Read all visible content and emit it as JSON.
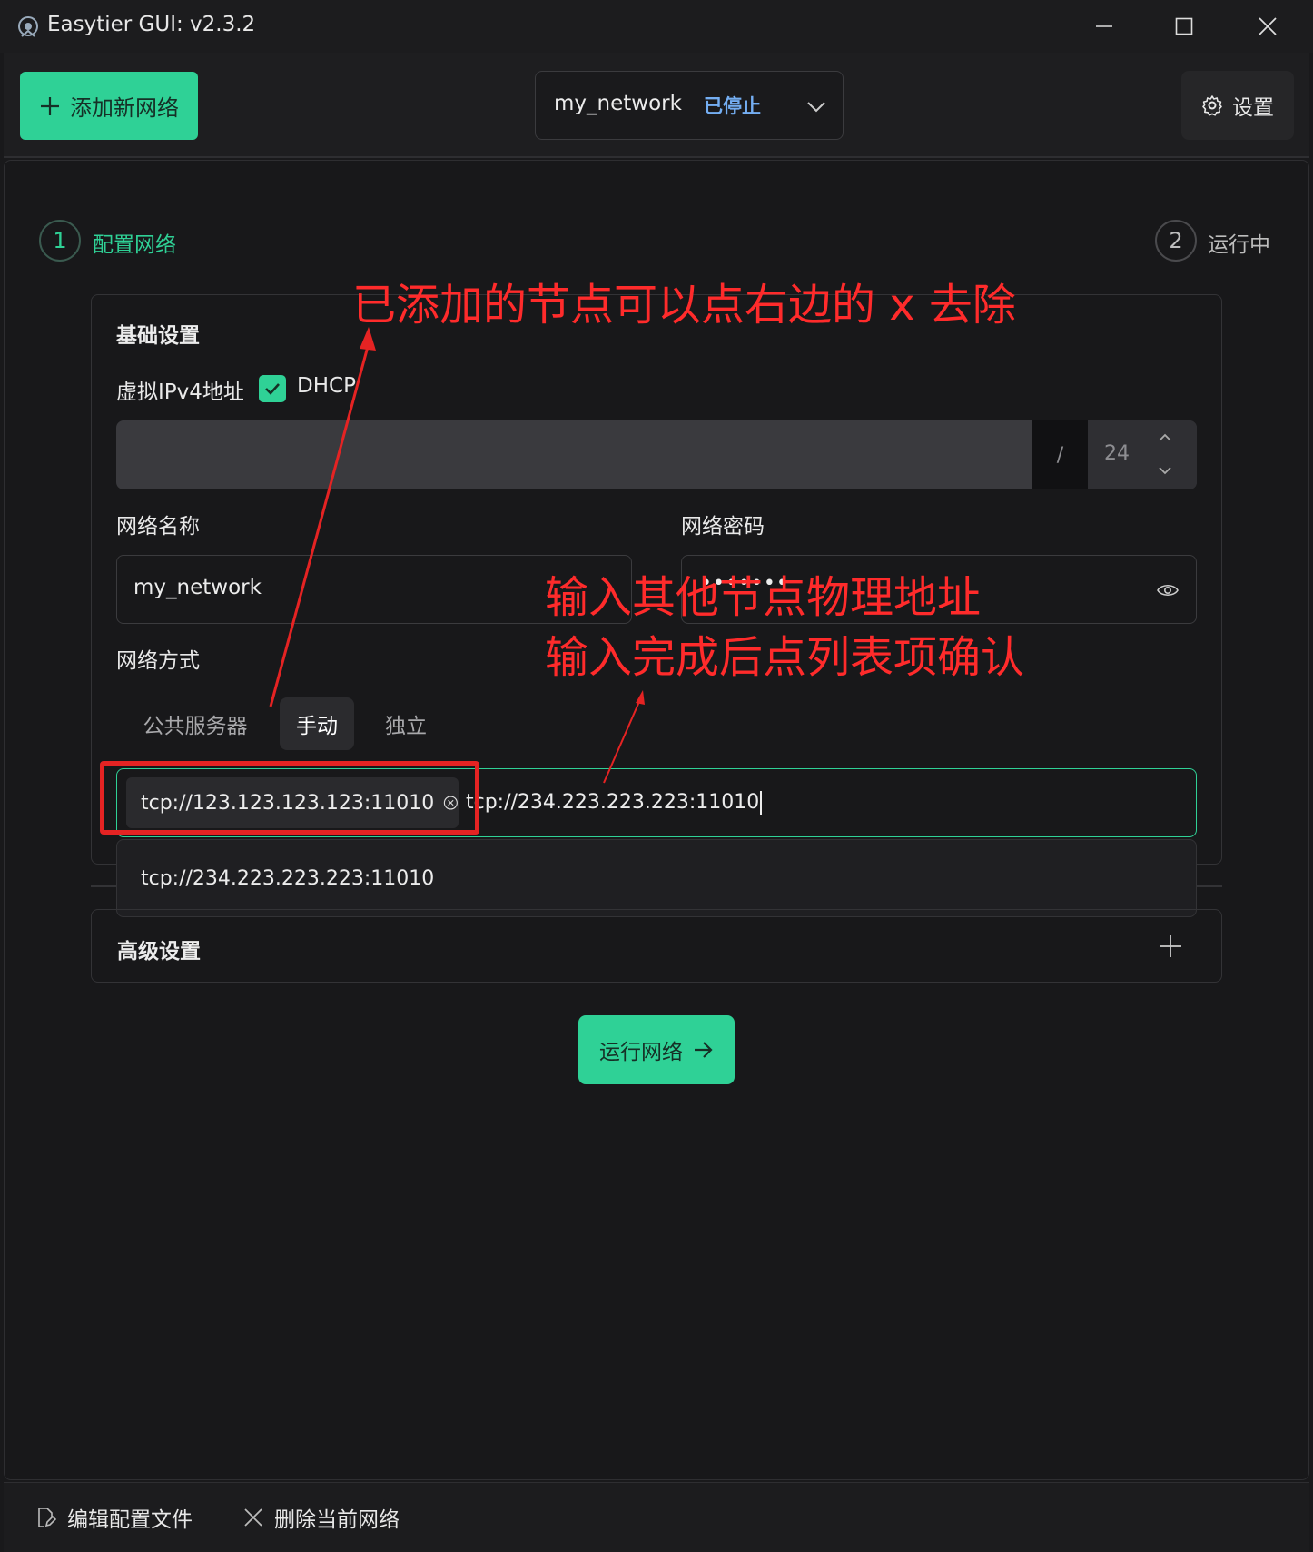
{
  "window": {
    "title": "Easytier GUI: v2.3.2",
    "controls": [
      "minimize-icon",
      "maximize-icon",
      "close-icon"
    ]
  },
  "header": {
    "add_network_label": "添加新网络",
    "network_select": {
      "name": "my_network",
      "status": "已停止"
    },
    "settings_label": "设置"
  },
  "steps": [
    {
      "number": "1",
      "label": "配置网络"
    },
    {
      "number": "2",
      "label": "运行中"
    }
  ],
  "basic_settings": {
    "title": "基础设置",
    "ipv4_label": "虚拟IPv4地址",
    "dhcp_label": "DHCP",
    "dhcp_checked": true,
    "ipv4_value": "",
    "ipv4_slash": "/",
    "ipv4_prefix": "24",
    "network_name_label": "网络名称",
    "network_name_value": "my_network",
    "network_password_label": "网络密码",
    "network_password_value": "•••••••",
    "network_mode_label": "网络方式",
    "mode_tabs": [
      "公共服务器",
      "手动",
      "独立"
    ],
    "selected_mode": "手动",
    "peers": {
      "added": [
        "tcp://123.123.123.123:11010"
      ],
      "typed_value": "tcp://234.223.223.223:11010",
      "suggestion": "tcp://234.223.223.223:11010"
    }
  },
  "advanced_settings": {
    "title": "高级设置"
  },
  "run_button_label": "运行网络",
  "footer": {
    "edit_config_label": "编辑配置文件",
    "delete_network_label": "删除当前网络"
  },
  "annotations": {
    "remove_hint": "已添加的节点可以点右边的 x 去除",
    "input_hint_1": "输入其他节点物理地址",
    "input_hint_2": "输入完成后点列表项确认"
  },
  "colors": {
    "accent": "#2fd196",
    "status_stopped": "#74aef2",
    "annotation": "#ff2b2b",
    "background": "#19191b"
  }
}
